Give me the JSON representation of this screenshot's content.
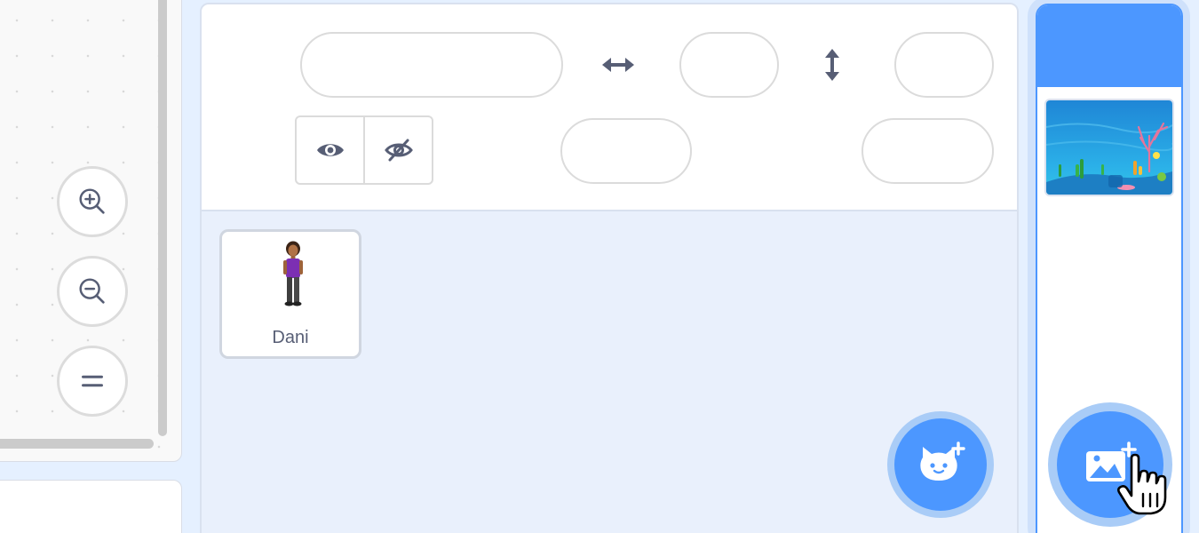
{
  "workspace": {
    "zoom_buttons": [
      {
        "icon": "zoom-in-icon"
      },
      {
        "icon": "zoom-out-icon"
      },
      {
        "icon": "zoom-reset-icon"
      }
    ]
  },
  "sprite_info": {
    "sprite_name_value": "",
    "x_value": "",
    "y_value": "",
    "size_value": "",
    "direction_value": "",
    "x_arrow_icon": "horizontal-arrow-icon",
    "y_arrow_icon": "vertical-arrow-icon",
    "show_icon": "eye-icon",
    "hide_icon": "eye-slash-icon"
  },
  "sprites": [
    {
      "name": "Dani"
    }
  ],
  "add_sprite": {
    "icon": "cat-plus-icon"
  },
  "stage": {
    "backdrop_icon": "underwater-backdrop",
    "add_backdrop_icon": "image-plus-icon"
  },
  "colors": {
    "accent": "#4c97ff",
    "accent_light": "#a9ccf7",
    "text": "#575e75",
    "border": "#d9e1ef"
  }
}
